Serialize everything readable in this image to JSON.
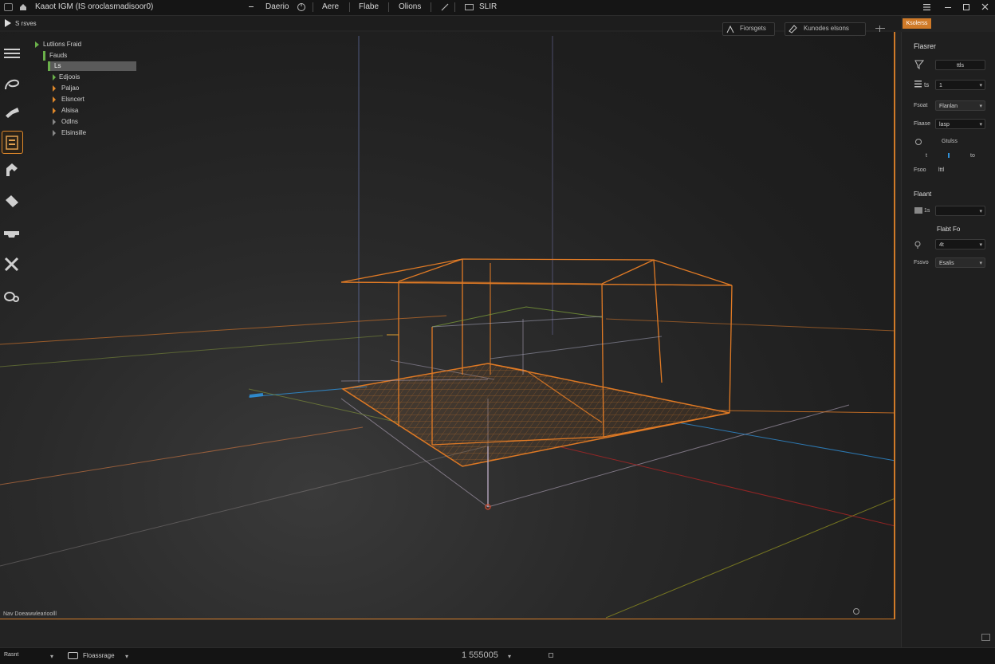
{
  "title_bar": {
    "app_title": "Kaaot IGM (IS oroclasmadisoor0)",
    "menus": [
      "Daerio",
      "Aere",
      "Flabe",
      "Olions",
      "SLIR"
    ],
    "window_controls": [
      "minimize",
      "maximize",
      "close"
    ]
  },
  "sub_bar": {
    "play_label": "S rsves",
    "viewport_buttons": [
      "Fiorsgets",
      "Kunodes elsons"
    ]
  },
  "outliner": {
    "items": [
      {
        "label": "Lutlions Fraid",
        "arrow": "green"
      },
      {
        "label": "Fauds",
        "arrow": "none"
      },
      {
        "label": "Ls",
        "arrow": "green",
        "selected": true
      },
      {
        "label": "Edjoois",
        "arrow": "green"
      },
      {
        "label": "Paljao",
        "arrow": "orange"
      },
      {
        "label": "Elsncert",
        "arrow": "orange"
      },
      {
        "label": "Alsisa",
        "arrow": "orange"
      },
      {
        "label": "Odlns",
        "arrow": "gray"
      },
      {
        "label": "Elsinsille",
        "arrow": "gray"
      }
    ]
  },
  "left_tools": [
    "menu-icon",
    "curve-icon",
    "camera-icon",
    "layer-icon",
    "path-icon",
    "bucket-icon",
    "vehicle-icon",
    "tools-icon",
    "link-icon"
  ],
  "right_panel": {
    "tab_label": "Ksolerss",
    "header": "Flasrer",
    "rows": [
      {
        "label": "",
        "field": "ttls"
      },
      {
        "label": "ts",
        "field": "1"
      },
      {
        "label": "Fsoat",
        "field": "Flanlan"
      },
      {
        "label": "Flaase",
        "field": "lasp"
      }
    ],
    "group1_label": "Gtulss",
    "group1_values": [
      "t",
      "to"
    ],
    "group1_row_label": "Fsoo",
    "group1_row_value": "lttl",
    "section2_header": "Flaant",
    "section2_row_label": "1s",
    "section3_header": "Flabt Fo",
    "section3_row_value": "4t",
    "section3_row2_label": "Fssvo",
    "section3_row2_value": "Esalis"
  },
  "viewport": {
    "corner_label": "Nav Doeawwlearioolll"
  },
  "bottom_bar": {
    "left_label": "Rasnt",
    "mode_label": "Floassrage",
    "frame_counter": "1 555005"
  },
  "colors": {
    "accent": "#e0882a",
    "wire": "#e07a25",
    "axis_blue": "#2f8fd6",
    "axis_red": "#c02525",
    "axis_green": "#6a9a2a"
  }
}
